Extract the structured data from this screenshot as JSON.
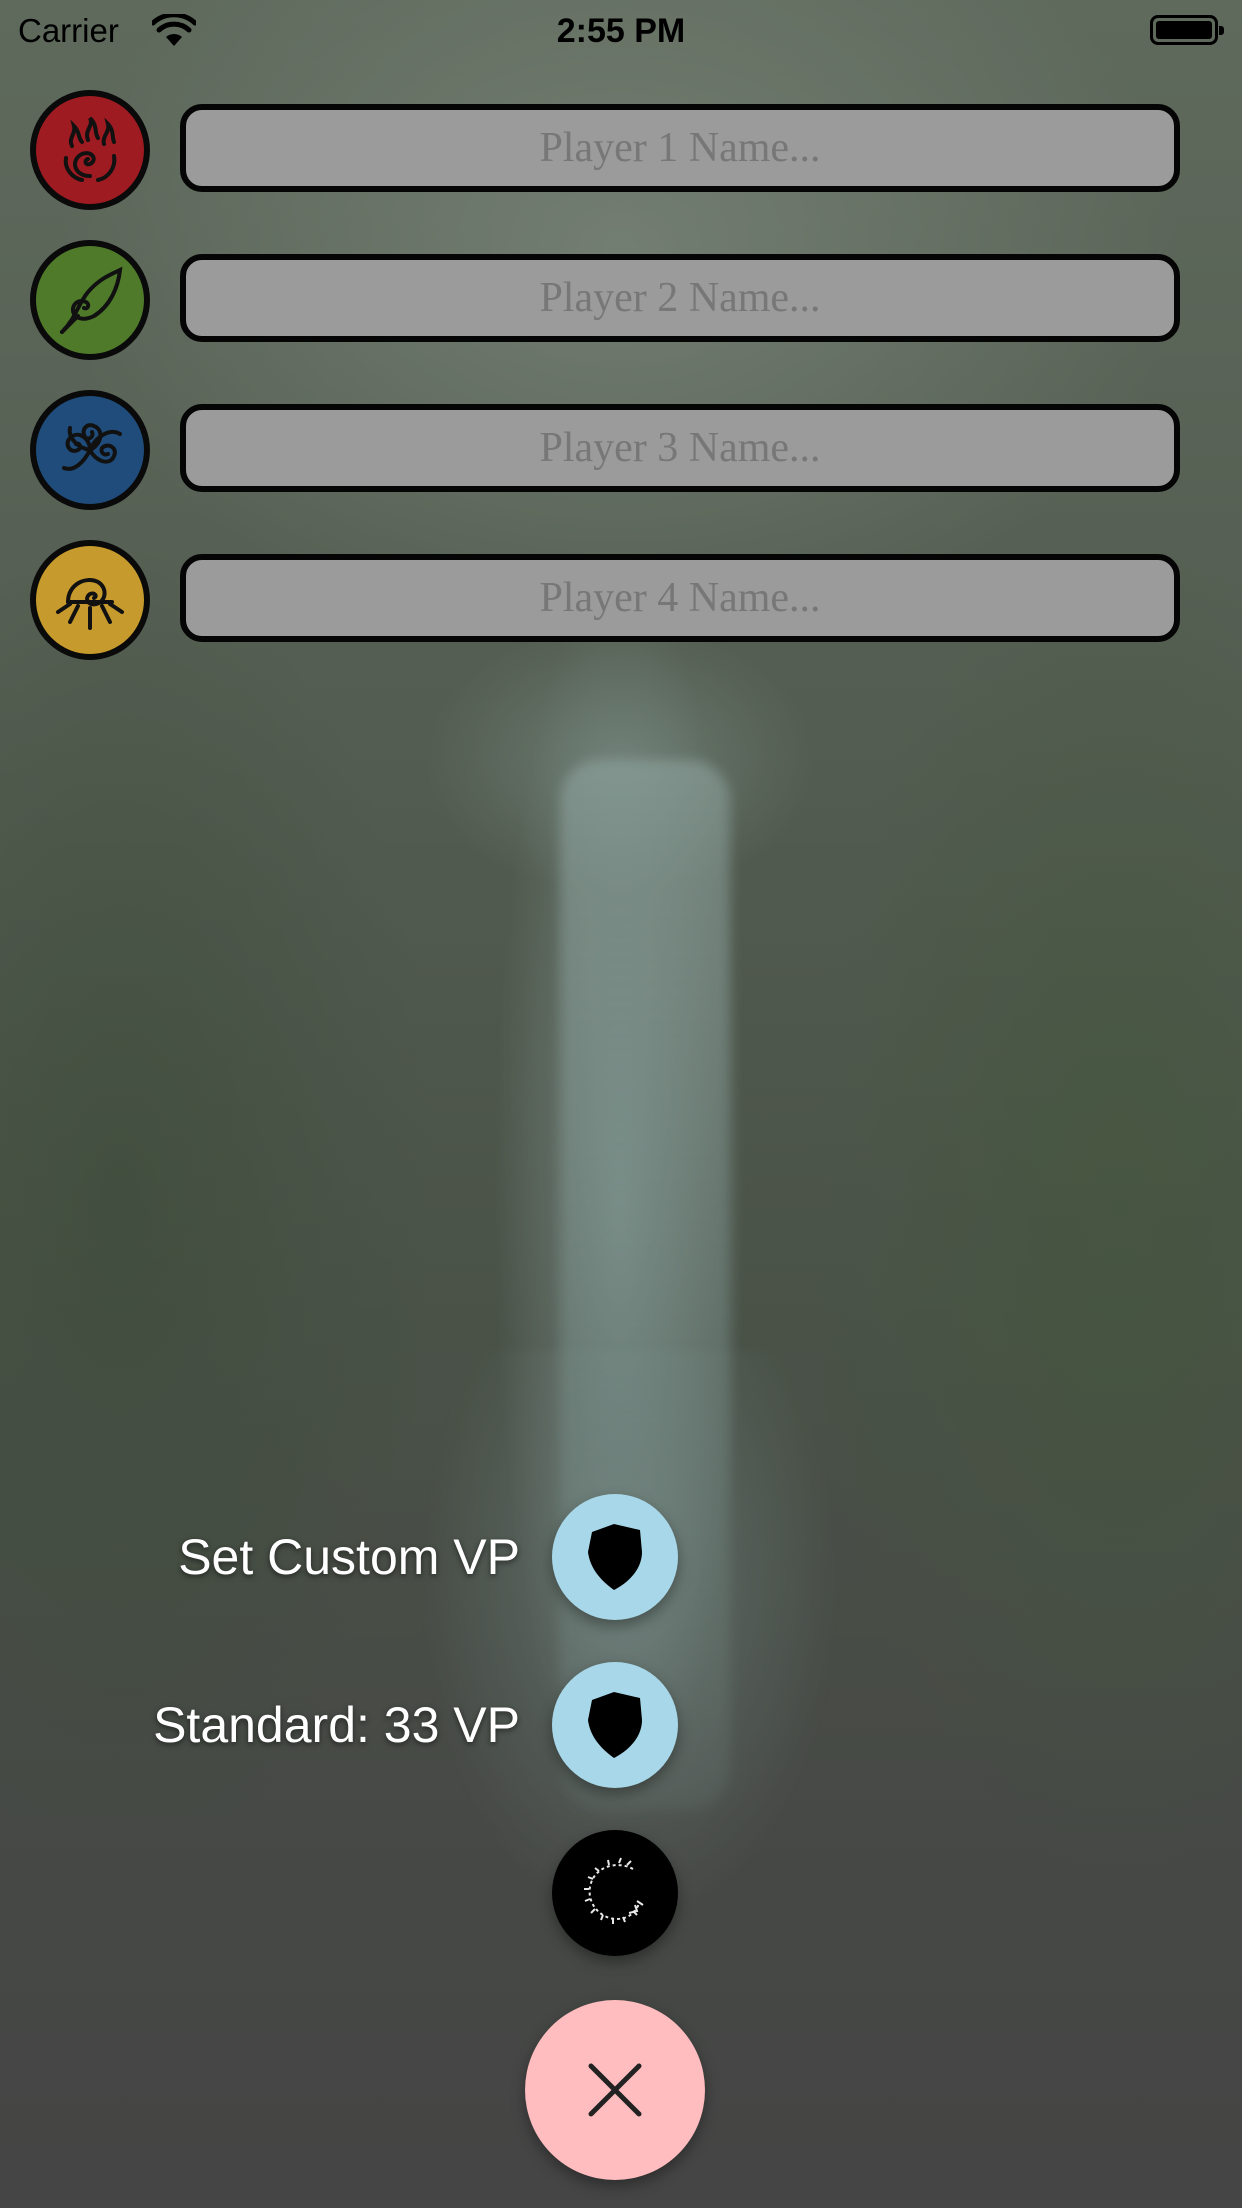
{
  "status_bar": {
    "carrier": "Carrier",
    "time": "2:55 PM"
  },
  "players": [
    {
      "placeholder": "Player 1 Name...",
      "value": "",
      "emblem_color": "#9e1b22",
      "icon": "fire-icon"
    },
    {
      "placeholder": "Player 2 Name...",
      "value": "",
      "emblem_color": "#4f7a2a",
      "icon": "leaf-icon"
    },
    {
      "placeholder": "Player 3 Name...",
      "value": "",
      "emblem_color": "#1f4c7a",
      "icon": "triskelion-icon"
    },
    {
      "placeholder": "Player 4 Name...",
      "value": "",
      "emblem_color": "#c69a2c",
      "icon": "sun-icon"
    }
  ],
  "fab_menu": {
    "custom_vp_label": "Set Custom VP",
    "standard_vp_label": "Standard: 33 VP",
    "custom_vp_icon": "shield-icon",
    "standard_vp_icon": "shield-icon",
    "third_icon": "laurel-wreath-icon",
    "close_icon": "close-icon",
    "colors": {
      "action_button": "#a7d7e8",
      "close_button": "#ffbdbf"
    }
  }
}
